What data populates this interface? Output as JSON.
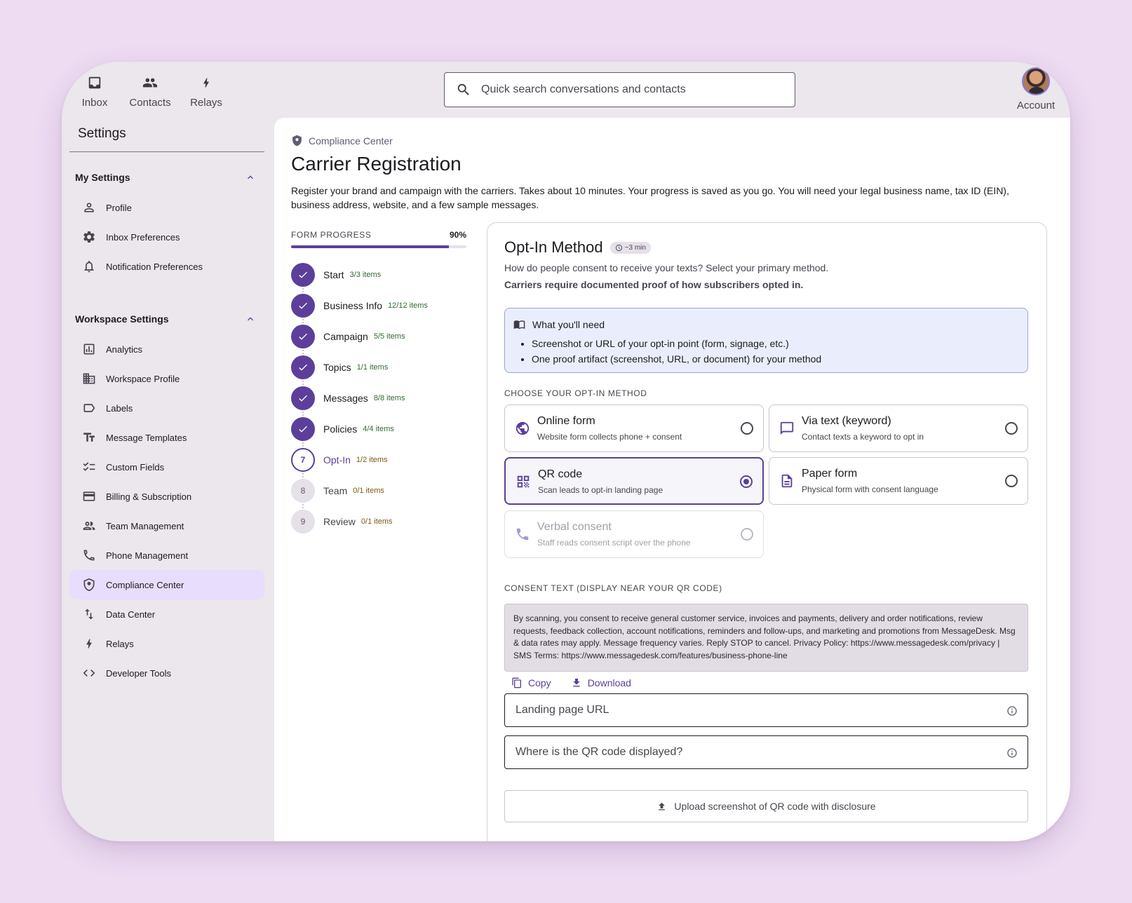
{
  "topnav": {
    "items": [
      {
        "label": "Inbox",
        "icon": "inbox-icon"
      },
      {
        "label": "Contacts",
        "icon": "people-icon"
      },
      {
        "label": "Relays",
        "icon": "bolt-icon"
      }
    ],
    "search_placeholder": "Quick search conversations and contacts",
    "account_label": "Account"
  },
  "sidebar": {
    "title": "Settings",
    "my_settings": {
      "label": "My Settings",
      "items": [
        {
          "label": "Profile",
          "icon": "person-icon"
        },
        {
          "label": "Inbox Preferences",
          "icon": "gear-icon"
        },
        {
          "label": "Notification Preferences",
          "icon": "bell-icon"
        }
      ]
    },
    "workspace_settings": {
      "label": "Workspace Settings",
      "items": [
        {
          "label": "Analytics",
          "icon": "analytics-icon"
        },
        {
          "label": "Workspace Profile",
          "icon": "building-icon"
        },
        {
          "label": "Labels",
          "icon": "label-icon"
        },
        {
          "label": "Message Templates",
          "icon": "text-format-icon"
        },
        {
          "label": "Custom Fields",
          "icon": "checklist-icon"
        },
        {
          "label": "Billing & Subscription",
          "icon": "credit-card-icon"
        },
        {
          "label": "Team Management",
          "icon": "team-icon"
        },
        {
          "label": "Phone Management",
          "icon": "phone-icon"
        },
        {
          "label": "Compliance Center",
          "icon": "shield-icon",
          "active": true
        },
        {
          "label": "Data Center",
          "icon": "swap-vertical-icon"
        },
        {
          "label": "Relays",
          "icon": "bolt-icon"
        },
        {
          "label": "Developer Tools",
          "icon": "code-icon"
        }
      ]
    }
  },
  "main": {
    "breadcrumb": "Compliance Center",
    "title": "Carrier Registration",
    "description": "Register your brand and campaign with the carriers. Takes about 10 minutes. Your progress is saved as you go. You will need your legal business name, tax ID (EIN), business address, website, and a few sample messages.",
    "progress": {
      "label": "FORM PROGRESS",
      "percent_text": "90%",
      "percent": 90,
      "steps": [
        {
          "num": "1",
          "name": "Start",
          "count": "3/3 items",
          "state": "done"
        },
        {
          "num": "2",
          "name": "Business Info",
          "count": "12/12 items",
          "state": "done"
        },
        {
          "num": "3",
          "name": "Campaign",
          "count": "5/5 items",
          "state": "done"
        },
        {
          "num": "4",
          "name": "Topics",
          "count": "1/1 items",
          "state": "done"
        },
        {
          "num": "5",
          "name": "Messages",
          "count": "8/8 items",
          "state": "done"
        },
        {
          "num": "6",
          "name": "Policies",
          "count": "4/4 items",
          "state": "done"
        },
        {
          "num": "7",
          "name": "Opt-In",
          "count": "1/2 items",
          "state": "current"
        },
        {
          "num": "8",
          "name": "Team",
          "count": "0/1 items",
          "state": "todo"
        },
        {
          "num": "9",
          "name": "Review",
          "count": "0/1 items",
          "state": "todo"
        }
      ]
    },
    "card": {
      "title": "Opt-In Method",
      "time_chip": "~3 min",
      "subtitle": "How do people consent to receive your texts? Select your primary method.",
      "subtitle_bold": "Carriers require documented proof of how subscribers opted in.",
      "needs": {
        "title": "What you'll need",
        "items": [
          "Screenshot or URL of your opt-in point (form, signage, etc.)",
          "One proof artifact (screenshot, URL, or document) for your method"
        ]
      },
      "choose_label": "CHOOSE YOUR OPT-IN METHOD",
      "options": [
        {
          "title": "Online form",
          "desc": "Website form collects phone + consent",
          "icon": "globe-icon",
          "selected": false,
          "disabled": false
        },
        {
          "title": "Via text (keyword)",
          "desc": "Contact texts a keyword to opt in",
          "icon": "chat-icon",
          "selected": false,
          "disabled": false
        },
        {
          "title": "QR code",
          "desc": "Scan leads to opt-in landing page",
          "icon": "qr-code-icon",
          "selected": true,
          "disabled": false
        },
        {
          "title": "Paper form",
          "desc": "Physical form with consent language",
          "icon": "document-icon",
          "selected": false,
          "disabled": false
        },
        {
          "title": "Verbal consent",
          "desc": "Staff reads consent script over the phone",
          "icon": "phone-icon",
          "selected": false,
          "disabled": true
        }
      ],
      "consent_label": "CONSENT TEXT (DISPLAY NEAR YOUR QR CODE)",
      "consent_text": "By scanning, you consent to receive general customer service, invoices and payments, delivery and order notifications, review requests, feedback collection, account notifications, reminders and follow-ups, and marketing and promotions from MessageDesk. Msg & data rates may apply. Message frequency varies. Reply STOP to cancel. Privacy Policy: https://www.messagedesk.com/privacy | SMS Terms: https://www.messagedesk.com/features/business-phone-line",
      "copy_label": "Copy",
      "download_label": "Download",
      "landing_placeholder": "Landing page URL",
      "location_placeholder": "Where is the QR code displayed?",
      "upload_label": "Upload screenshot of QR code with disclosure"
    }
  },
  "colors": {
    "accent": "#5b3f9a",
    "page_bg": "#eedcf3",
    "active_nav": "#e8ddfc",
    "info_bg": "#eaeefc"
  }
}
